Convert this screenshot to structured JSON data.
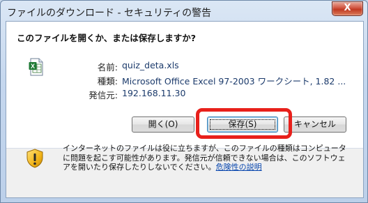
{
  "window": {
    "title": "ファイルのダウンロード - セキュリティの警告",
    "close_label": "X"
  },
  "dialog": {
    "question": "このファイルを開くか、または保存しますか?",
    "file_icon": "excel-file-icon",
    "fields": [
      {
        "label": "名前:",
        "value": "quiz_deta.xls"
      },
      {
        "label": "種類:",
        "value": "Microsoft Office Excel 97-2003 ワークシート, 1.82 ..."
      },
      {
        "label": "発信元:",
        "value": "192.168.11.30"
      }
    ],
    "buttons": {
      "open": "開く(O)",
      "save": "保存(S)",
      "cancel": "キャンセル"
    },
    "warning": {
      "icon": "shield-warning-icon",
      "text": "インターネットのファイルは役に立ちますが、このファイルの種類はコンピュータに問題を起こす可能性があります。発信元が信頼できない場合は、このソフトウェアを開いたり保存したりしないでください。",
      "link": "危険性の説明"
    },
    "highlight_color": "#e8201b"
  }
}
